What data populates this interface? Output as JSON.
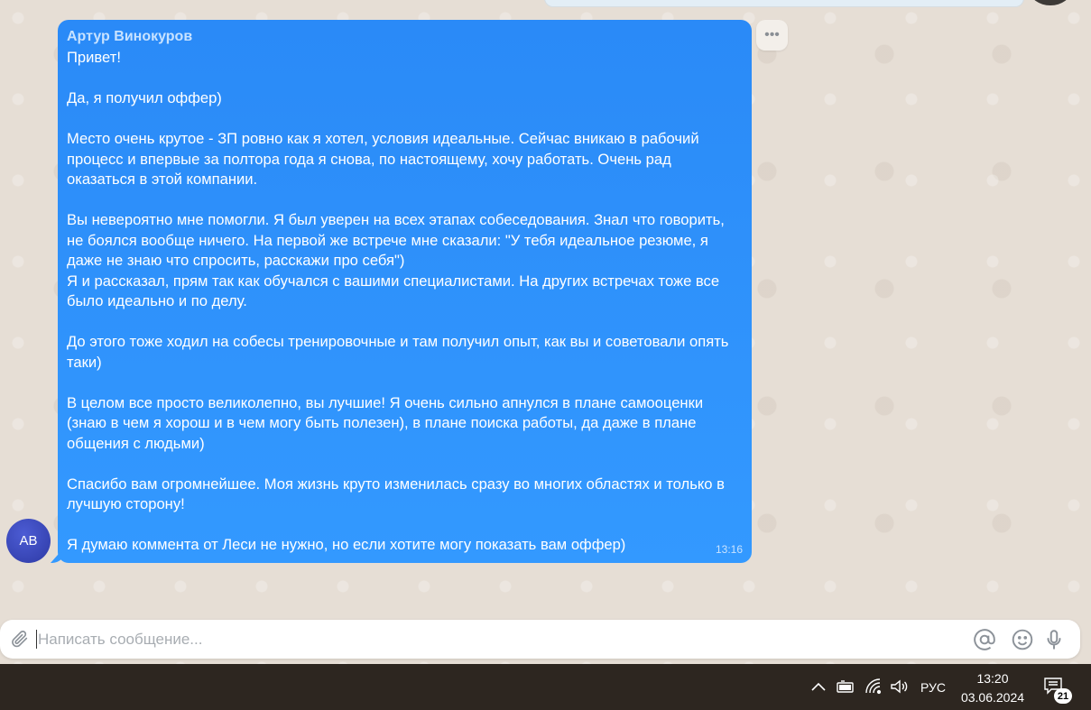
{
  "message": {
    "sender": "Артур Винокуров",
    "text": "Привет!\n\nДа, я получил оффер)\n\nМесто очень крутое - ЗП ровно как я хотел, условия идеальные. Сейчас вникаю в рабочий процесс и впервые за полтора года я снова, по настоящему, хочу работать. Очень рад оказаться в этой компании.\n\nВы невероятно мне помогли. Я был уверен на всех этапах собеседования. Знал что говорить, не боялся вообще ничего. На первой же встрече мне сказали: \"У тебя идеальное резюме, я даже не знаю что спросить, расскажи про себя\")\nЯ и рассказал, прям так как обучался с вашими специалистами. На других встречах тоже все было идеально и по делу.\n\nДо этого тоже ходил на собесы тренировочные и там получил опыт, как вы и советовали опять таки)\n\nВ целом все просто великолепно, вы лучшие! Я очень сильно апнулся в плане самооценки (знаю в чем я хорош и в чем могу быть полезен), в плане поиска работы, да даже в плане общения с людьми)\n\nСпасибо вам огромнейшее. Моя жизнь круто изменилась сразу во многих областях и только в лучшую сторону!\n\nЯ думаю коммента от Леси не нужно, но если хотите могу показать вам оффер)",
    "time": "13:16",
    "avatar_initials": "АВ",
    "more_icon": "•••"
  },
  "composer": {
    "placeholder": "Написать сообщение...",
    "icons": [
      "paperclip-icon",
      "mention-icon",
      "emoji-icon",
      "microphone-icon"
    ]
  },
  "taskbar": {
    "language": "РУС",
    "time": "13:20",
    "date": "03.06.2024",
    "notification_count": "21",
    "icons": [
      "chevron-up-icon",
      "battery-icon",
      "wifi-icon",
      "volume-icon",
      "notification-icon"
    ]
  },
  "colors": {
    "bubble": "#2a8af7",
    "chat_background": "#e6ded5",
    "taskbar": "#2d2620",
    "avatar": "#3b4bc4"
  }
}
